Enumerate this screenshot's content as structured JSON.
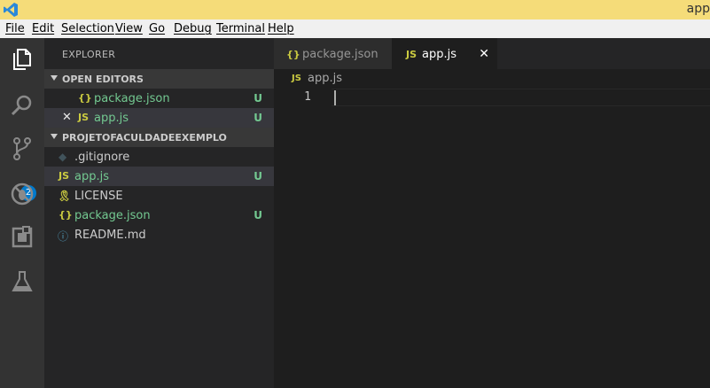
{
  "window": {
    "title": "app"
  },
  "menu": [
    "File",
    "Edit",
    "Selection",
    "View",
    "Go",
    "Debug",
    "Terminal",
    "Help"
  ],
  "activity_bar": {
    "items": [
      "files-icon",
      "search-icon",
      "source-control-icon",
      "debug-icon",
      "extensions-icon",
      "flask-icon"
    ],
    "scm_badge": "2"
  },
  "sidebar": {
    "title": "EXPLORER",
    "open_editors": {
      "label": "OPEN EDITORS",
      "items": [
        {
          "icon": "{}",
          "name": "package.json",
          "status": "U"
        },
        {
          "icon": "JS",
          "name": "app.js",
          "status": "U",
          "close": "✕"
        }
      ]
    },
    "project": {
      "label": "PROJETOFACULDADEEXEMPLO",
      "items": [
        {
          "icon": "◆",
          "name": ".gitignore",
          "status": ""
        },
        {
          "icon": "JS",
          "name": "app.js",
          "status": "U"
        },
        {
          "icon": "🎗",
          "name": "LICENSE",
          "status": ""
        },
        {
          "icon": "{}",
          "name": "package.json",
          "status": "U"
        },
        {
          "icon": "ⓘ",
          "name": "README.md",
          "status": ""
        }
      ]
    }
  },
  "tabs": [
    {
      "icon": "{}",
      "name": "package.json",
      "active": false
    },
    {
      "icon": "JS",
      "name": "app.js",
      "active": true,
      "close": "✕"
    }
  ],
  "breadcrumb": {
    "icon": "JS",
    "name": "app.js"
  },
  "editor": {
    "line_number": "1"
  },
  "colors": {
    "titlebar": "#f5dc79",
    "accent": "#007acc",
    "untracked": "#73c991",
    "js_icon": "#cbcb41"
  }
}
